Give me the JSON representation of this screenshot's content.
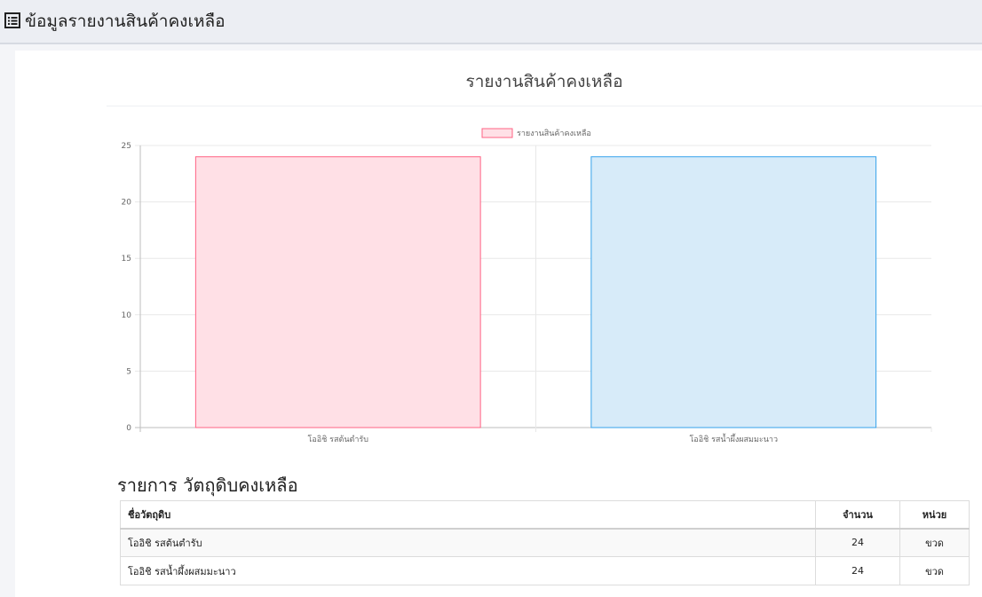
{
  "header": {
    "title": "ข้อมูลรายงานสินค้าคงเหลือ",
    "icon": "list-icon"
  },
  "chart_data": {
    "type": "bar",
    "title": "รายงานสินค้าคงเหลือ",
    "categories": [
      "โออิชิ รสต้นตำรับ",
      "โออิชิ รสน้ำผึ้งผสมมะนาว"
    ],
    "series": [
      {
        "name": "รายงานสินค้าคงเหลือ",
        "values": [
          24,
          24
        ]
      }
    ],
    "bar_colors": [
      {
        "fill": "#ffe0e6",
        "stroke": "#ff6384"
      },
      {
        "fill": "#d7ebf9",
        "stroke": "#36a2eb"
      }
    ],
    "ylim": [
      0,
      25
    ],
    "yticks": [
      0,
      5,
      10,
      15,
      20,
      25
    ],
    "xlabel": "",
    "ylabel": "",
    "grid": true,
    "legend": "top-center"
  },
  "section": {
    "title": "รายการ วัตถุดิบคงเหลือ"
  },
  "table": {
    "headers": {
      "name": "ชื่อวัตถุดิบ",
      "qty": "จำนวน",
      "unit": "หน่วย"
    },
    "rows": [
      {
        "name": "โออิชิ รสต้นตำรับ",
        "qty": "24",
        "unit": "ขวด"
      },
      {
        "name": "โออิชิ รสน้ำผึ้งผสมมะนาว",
        "qty": "24",
        "unit": "ขวด"
      }
    ]
  }
}
